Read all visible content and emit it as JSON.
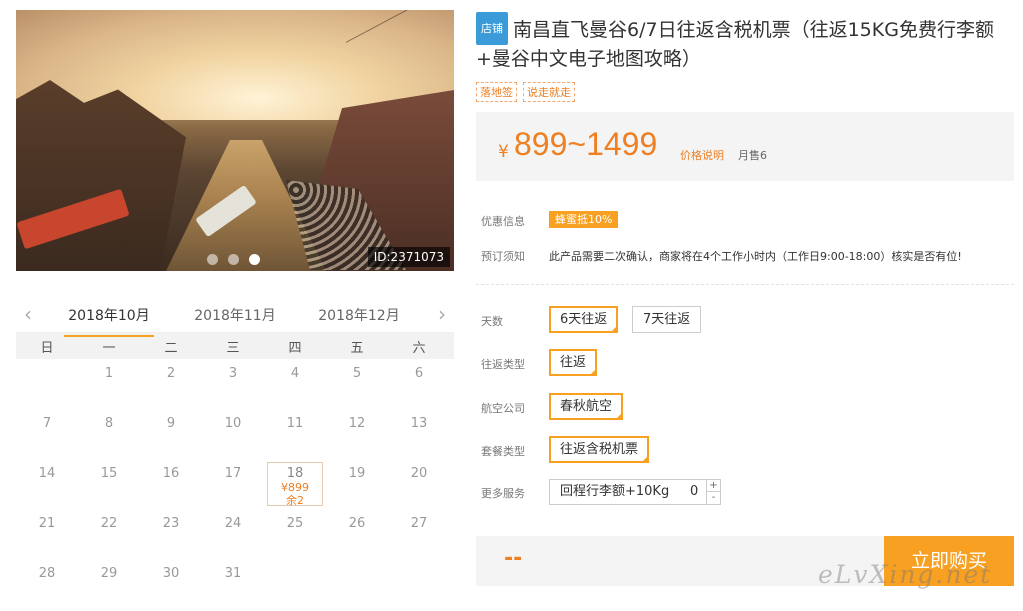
{
  "photo": {
    "id_label": "ID:2371073",
    "dots": 3,
    "active_dot": 3
  },
  "calendar": {
    "prev_arrow": "‹",
    "next_arrow": "›",
    "months": [
      "2018年10月",
      "2018年11月",
      "2018年12月"
    ],
    "active_month": 0,
    "weekdays": [
      "日",
      "一",
      "二",
      "三",
      "四",
      "五",
      "六"
    ],
    "rows": [
      [
        "",
        "1",
        "2",
        "3",
        "4",
        "5",
        "6"
      ],
      [
        "7",
        "8",
        "9",
        "10",
        "11",
        "12",
        "13"
      ],
      [
        "14",
        "15",
        "16",
        "17",
        "18",
        "19",
        "20"
      ],
      [
        "21",
        "22",
        "23",
        "24",
        "25",
        "26",
        "27"
      ],
      [
        "28",
        "29",
        "30",
        "31",
        "",
        "",
        ""
      ]
    ],
    "available": {
      "day": "18",
      "price": "¥899",
      "remaining": "余2"
    }
  },
  "product": {
    "shop_tag": "店铺",
    "title": "南昌直飞曼谷6/7日往返含税机票（往返15KG免费行李额+曼谷中文电子地图攻略）",
    "tags": [
      "落地签",
      "说走就走"
    ]
  },
  "price": {
    "currency": "¥",
    "range": "899~1499",
    "explain": "价格说明",
    "sold": "月售6"
  },
  "info": {
    "promo_label": "优惠信息",
    "promo_value": "蜂蜜抵10%",
    "notice_label": "预订须知",
    "notice_value": "此产品需要二次确认，商家将在4个工作小时内（工作日9:00-18:00）核实是否有位!"
  },
  "options": {
    "days_label": "天数",
    "days": [
      "6天往返",
      "7天往返"
    ],
    "trip_type_label": "往返类型",
    "trip_type": "往返",
    "airline_label": "航空公司",
    "airline": "春秋航空",
    "package_label": "套餐类型",
    "package": "往返含税机票",
    "service_label": "更多服务",
    "service_name": "回程行李额+10Kg",
    "service_qty": "0",
    "plus": "+",
    "minus": "-"
  },
  "buy": {
    "total": "--",
    "button": "立即购买"
  },
  "watermark": "eLvXing.net"
}
